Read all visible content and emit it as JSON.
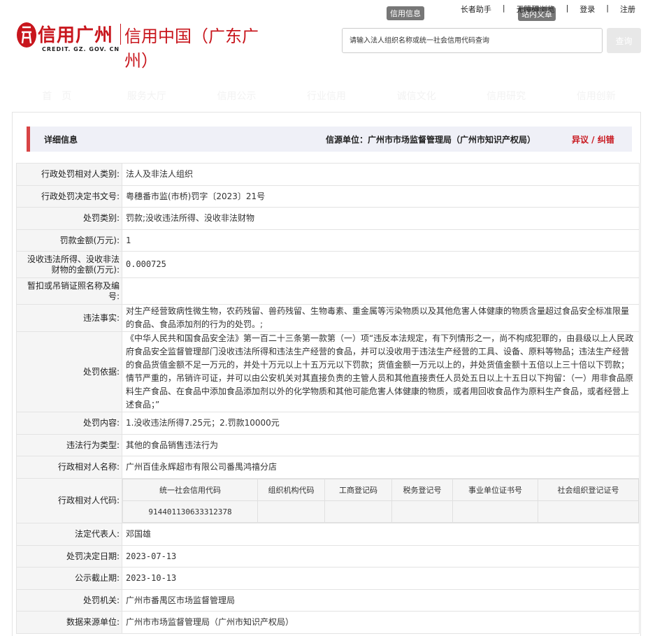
{
  "header": {
    "top_links": [
      "长者助手",
      "无障碍浏览",
      "登录",
      "注册"
    ],
    "tags": {
      "credit_info": "信用信息",
      "site_article": "站内文章"
    },
    "logo_cn": "信用广州",
    "logo_en": "CREDIT. GZ. GOV. CN",
    "site_name": "信用中国（广东广州）",
    "search_placeholder": "请输入法人组织名称或统一社会信用代码查询",
    "search_button": "查询"
  },
  "nav": [
    "首　页",
    "服务大厅",
    "信用公示",
    "行业信用",
    "诚信文化",
    "信用研究",
    "信用创新"
  ],
  "detail": {
    "title": "详细信息",
    "source": "信源单位：广州市市场监督管理局（广州市知识产权局）",
    "error_link": "异议 / 纠错"
  },
  "rows": {
    "party_type": {
      "label": "行政处罚相对人类别:",
      "value": "法人及非法人组织"
    },
    "decision_no": {
      "label": "行政处罚决定书文号:",
      "value": "粤穗番市监(市桥)罚字〔2023〕21号"
    },
    "penalty_type": {
      "label": "处罚类别:",
      "value": "罚款;没收违法所得、没收非法财物"
    },
    "fine": {
      "label": "罚款金额(万元):",
      "value": "1"
    },
    "confiscated": {
      "label": "没收违法所得、没收非法财物的金额(万元):",
      "value": "0.000725"
    },
    "license": {
      "label": "暂扣或吊销证照名称及编号:",
      "value": ""
    },
    "facts": {
      "label": "违法事实:",
      "value": "对生产经营致病性微生物，农药残留、兽药残留、生物毒素、重金属等污染物质以及其他危害人体健康的物质含量超过食品安全标准限量的食品、食品添加剂的行为的处罚。;"
    },
    "basis": {
      "label": "处罚依据:",
      "value": "《中华人民共和国食品安全法》第一百二十三条第一款第（一）项“违反本法规定，有下列情形之一，尚不构成犯罪的，由县级以上人民政府食品安全监督管理部门没收违法所得和违法生产经营的食品，并可以没收用于违法生产经营的工具、设备、原料等物品；违法生产经营的食品货值金额不足一万元的，并处十万元以上十五万元以下罚款；货值金额一万元以上的，并处货值金额十五倍以上三十倍以下罚款；情节严重的，吊销许可证，并可以由公安机关对其直接负责的主管人员和其他直接责任人员处五日以上十五日以下拘留：（一）用非食品原料生产食品、在食品中添加食品添加剂以外的化学物质和其他可能危害人体健康的物质，或者用回收食品作为原料生产食品，或者经营上述食品；”"
    },
    "content": {
      "label": "处罚内容:",
      "value": "1.没收违法所得7.25元；2.罚款10000元"
    },
    "violation_type": {
      "label": "违法行为类型:",
      "value": "其他的食品销售违法行为"
    },
    "party_name": {
      "label": "行政相对人名称:",
      "value": "广州百佳永辉超市有限公司番禺鸿禧分店"
    },
    "party_code": {
      "label": "行政相对人代码:"
    },
    "legal_rep": {
      "label": "法定代表人:",
      "value": "邓国雄"
    },
    "decision_date": {
      "label": "处罚决定日期:",
      "value": "2023-07-13"
    },
    "publish_end": {
      "label": "公示截止期:",
      "value": "2023-10-13"
    },
    "authority": {
      "label": "处罚机关:",
      "value": "广州市番禺区市场监督管理局"
    },
    "data_source": {
      "label": "数据来源单位:",
      "value": "广州市市场监督管理局（广州市知识产权局）"
    }
  },
  "codes": {
    "headers": [
      "统一社会信用代码",
      "组织机构代码",
      "工商登记码",
      "税务登记号",
      "事业单位证书号",
      "社会组织登记证号"
    ],
    "values": [
      "914401130633312378",
      "",
      "",
      "",
      "",
      ""
    ]
  }
}
